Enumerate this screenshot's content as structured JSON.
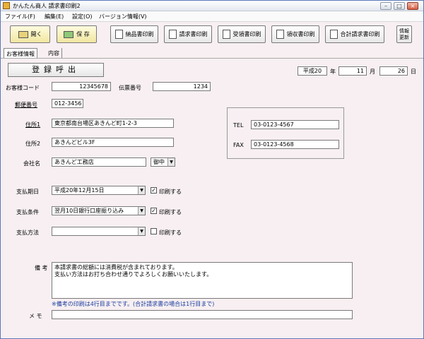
{
  "window": {
    "title": "かんたん商人 請求書印刷2"
  },
  "menu": [
    "ファイル(F)",
    "編集(E)",
    "設定(O)",
    "バージョン情報(V)"
  ],
  "toolbar": {
    "open": "開く",
    "save": "保 存",
    "delivery_print": "納品書印刷",
    "invoice_print": "請求書印刷",
    "acceptance_print": "受領書印刷",
    "receipt_print": "領収書印刷",
    "total_invoice_print": "合計請求書印刷",
    "info_refresh_line1": "情報",
    "info_refresh_line2": "更新"
  },
  "tabs": [
    "お客様情報",
    "内容"
  ],
  "register_button": "登録呼出",
  "date": {
    "era": "平成20",
    "year_unit": "年",
    "month": "11",
    "month_unit": "月",
    "day": "26",
    "day_unit": "日"
  },
  "customer": {
    "code_label": "お客様コード",
    "code": "12345678",
    "slip_label": "伝票番号",
    "slip": "1234",
    "postal_label": "郵便番号",
    "postal": "012-3456",
    "address1_label": "住所1",
    "address1": "東京都南台場区あきんど町1-2-3",
    "address2_label": "住所2",
    "address2": "あきんどビル3F",
    "company_label": "会社名",
    "company": "あきんど工務店",
    "honorific": "御中"
  },
  "contact": {
    "tel_label": "TEL",
    "tel": "03-0123-4567",
    "fax_label": "FAX",
    "fax": "03-0123-4568"
  },
  "payment": {
    "due_label": "支払期日",
    "due": "平成20年12月15日",
    "due_print": "印刷する",
    "terms_label": "支払条件",
    "terms": "翌月10日銀行口座振り込み",
    "terms_print": "印刷する",
    "method_label": "支払方法",
    "method": "",
    "method_print": "印刷する"
  },
  "remarks": {
    "label": "備 考",
    "line1": "本請求書の総額には消費税が含まれております。",
    "line2": "支払い方法はお打ち合わせ通りでよろしくお願いいたします。",
    "note": "※備考の印刷は4行目までです。(合計請求書の場合は1行目まで)"
  },
  "memo": {
    "label": "メ モ",
    "value": ""
  }
}
